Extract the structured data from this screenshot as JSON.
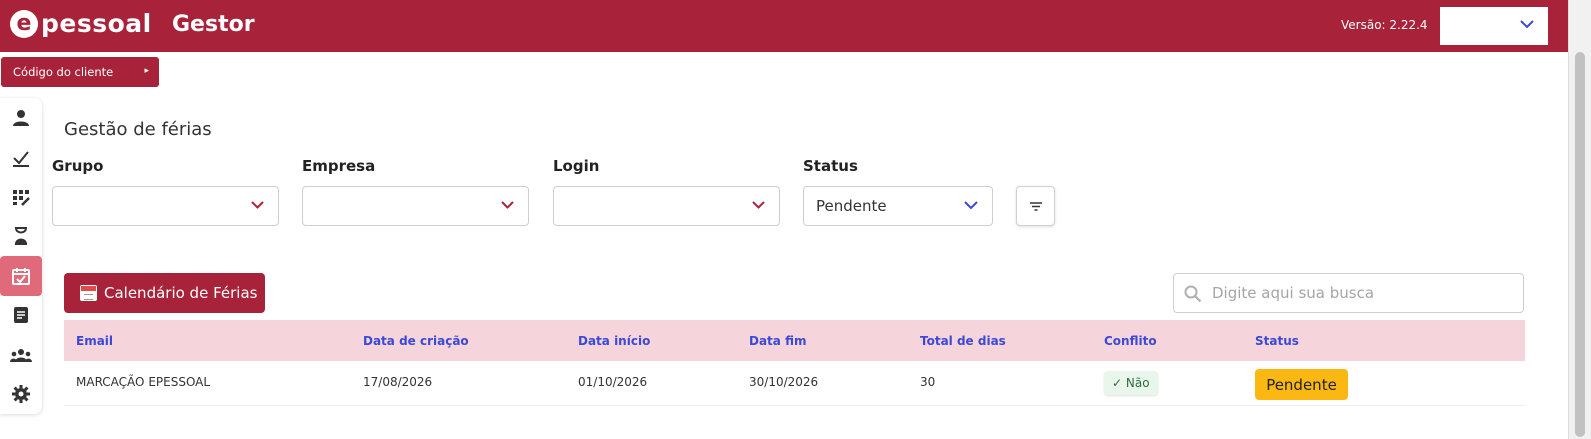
{
  "header": {
    "logo_mark": "e",
    "logo_text": "pessoal",
    "app_name": "Gestor",
    "version": "Versão: 2.22.4",
    "brand_color": "#a8233a"
  },
  "client_code": {
    "label": "Código do cliente"
  },
  "sidebar": {
    "items": [
      {
        "icon": "person-icon"
      },
      {
        "icon": "checkmark-icon"
      },
      {
        "icon": "grid-edit-icon"
      },
      {
        "icon": "hourglass-icon"
      },
      {
        "icon": "calendar-check-icon",
        "active": true
      },
      {
        "icon": "document-icon"
      },
      {
        "icon": "group-icon"
      },
      {
        "icon": "gear-icon"
      }
    ]
  },
  "page": {
    "title": "Gestão de férias"
  },
  "filters": {
    "grupo": {
      "label": "Grupo",
      "value": ""
    },
    "empresa": {
      "label": "Empresa",
      "value": ""
    },
    "login": {
      "label": "Login",
      "value": ""
    },
    "status": {
      "label": "Status",
      "value": "Pendente"
    }
  },
  "actions": {
    "calendar_button": "Calendário de Férias",
    "search_placeholder": "Digite aqui sua busca"
  },
  "table": {
    "columns": [
      "Email",
      "Data de criação",
      "Data início",
      "Data fim",
      "Total de dias",
      "Conflito",
      "Status"
    ],
    "rows": [
      {
        "email": "MARCAÇÃO EPESSOAL",
        "created": "17/08/2026",
        "start": "01/10/2026",
        "end": "30/10/2026",
        "total_days": "30",
        "conflict": "✓ Não",
        "status": "Pendente"
      }
    ]
  },
  "colors": {
    "header_bg": "#a8233a",
    "table_header_bg": "#f5d5db",
    "table_header_text": "#3b49d6",
    "status_pending": "#fbb812",
    "conflict_no_bg": "#e8f6ec",
    "sidebar_active": "#e06a7a"
  }
}
